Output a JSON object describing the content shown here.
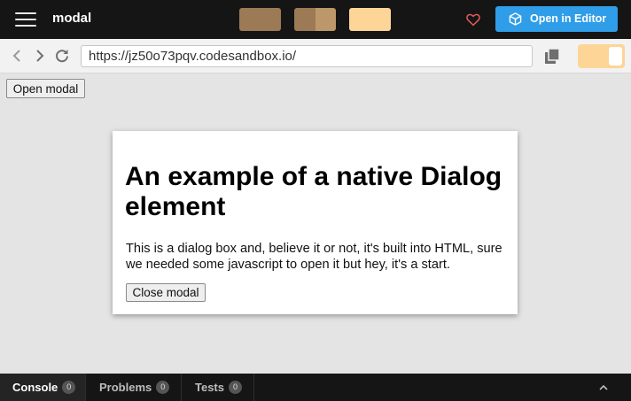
{
  "topbar": {
    "title": "modal",
    "open_editor_label": "Open in Editor",
    "colors": {
      "background": "#151515",
      "swatch_1": "#9c7a56",
      "swatch_2_left": "#9c7a56",
      "swatch_2_right": "#bc976a",
      "swatch_3": "#fcd597",
      "heart": "#e45b5b",
      "open_editor_button": "#2f9de8"
    }
  },
  "address_bar": {
    "url": "https://jz50o73pqv.codesandbox.io/",
    "toggle_color": "#fcd597"
  },
  "preview": {
    "open_modal_label": "Open modal",
    "dialog": {
      "heading": "An example of a native Dialog element",
      "body": "This is a dialog box and, believe it or not, it's built into HTML, sure we needed some javascript to open it but hey, it's a start.",
      "close_label": "Close modal"
    }
  },
  "bottom_panel": {
    "tabs": [
      {
        "label": "Console",
        "count": "0",
        "active": true
      },
      {
        "label": "Problems",
        "count": "0",
        "active": false
      },
      {
        "label": "Tests",
        "count": "0",
        "active": false
      }
    ]
  }
}
